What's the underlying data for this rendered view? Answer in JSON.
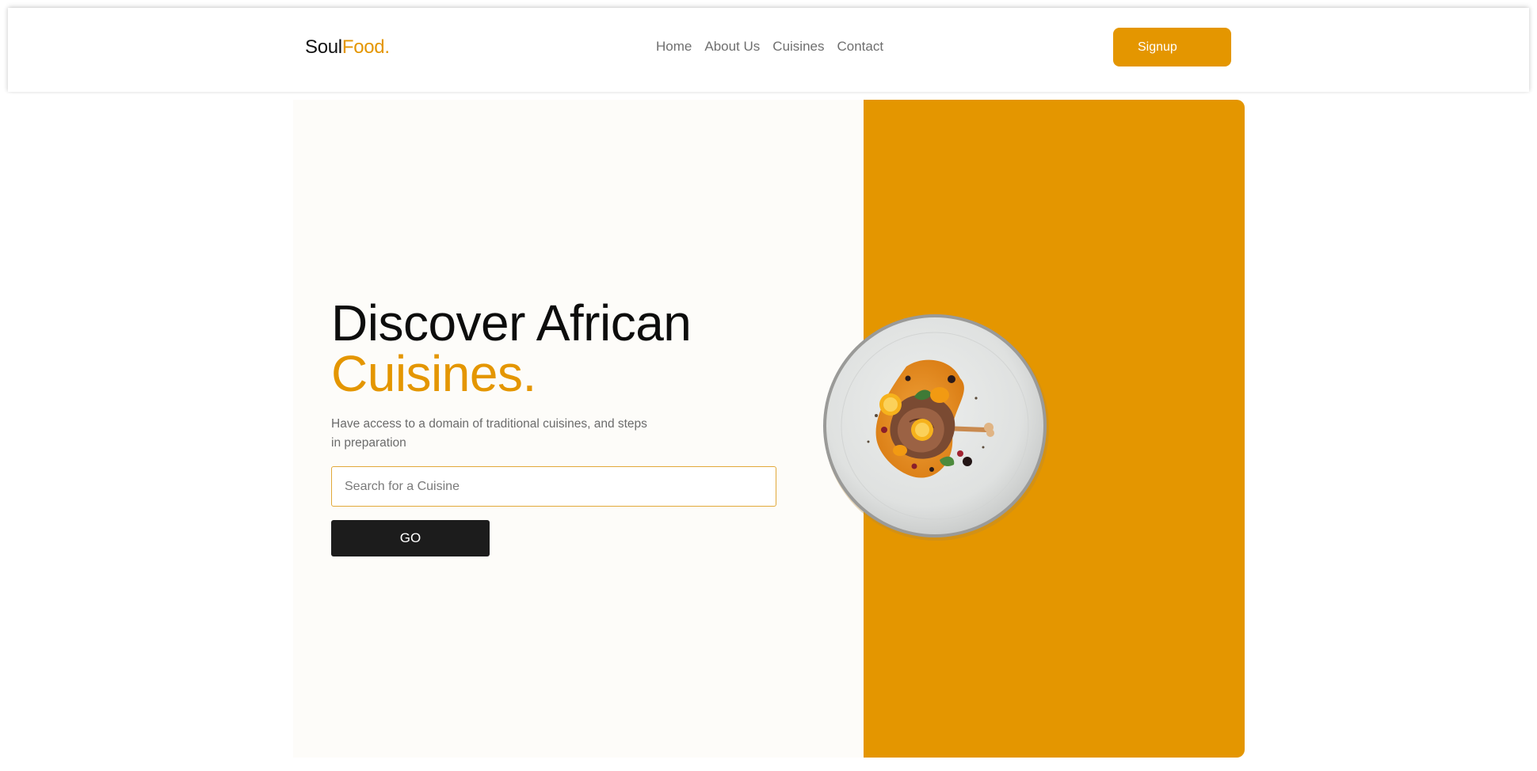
{
  "navbar": {
    "logo": {
      "primary": "Soul",
      "accent": "Food."
    },
    "links": [
      {
        "label": "Home"
      },
      {
        "label": "About Us"
      },
      {
        "label": "Cuisines"
      },
      {
        "label": "Contact"
      }
    ],
    "signup_label": "Signup"
  },
  "hero": {
    "headline_line1": "Discover African",
    "headline_line2": "Cuisines.",
    "subtitle": "Have access to a domain of traditional cuisines, and steps in preparation",
    "search": {
      "placeholder": "Search for a Cuisine",
      "value": ""
    },
    "go_label": "GO",
    "image_icon": "plated-dish-image"
  },
  "colors": {
    "accent": "#e49600",
    "dark_button": "#1c1c1c",
    "hero_left_bg": "#fdfcf9",
    "text_dark": "#0d0d0d",
    "text_muted": "#6b6b6b"
  }
}
